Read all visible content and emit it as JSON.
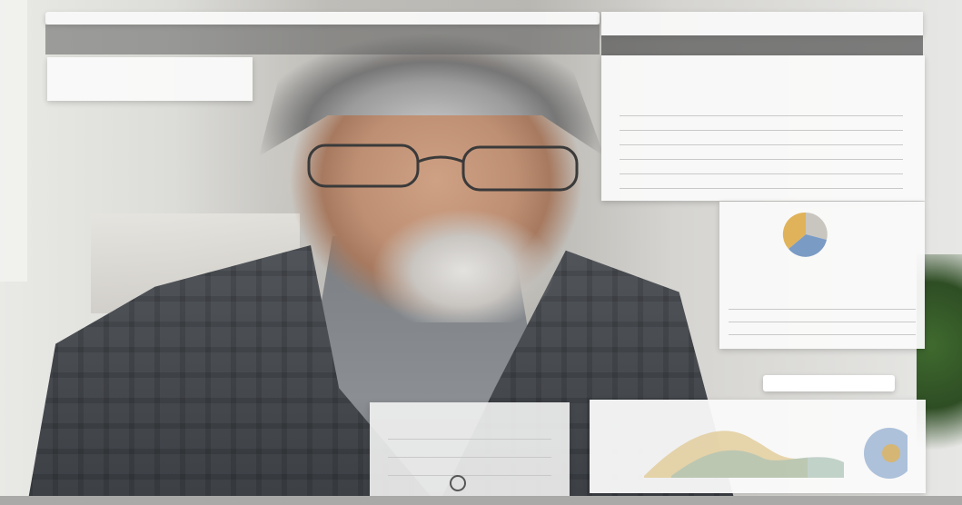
{
  "photo": {
    "subject": "",
    "backdrop_colors": {
      "wall": "#e4e4e1",
      "jacket": "#46494d",
      "shirt": "#858a8f",
      "skin": "#c4967a",
      "hair": "#9d9d9d"
    }
  },
  "overlay": {
    "top_bar": {
      "left_text": "",
      "right_text": ""
    },
    "dark_band": {
      "title": ""
    },
    "notification_card": {
      "title": "",
      "subtitle": ""
    },
    "report_panel": {
      "heading": "",
      "subheading": "",
      "rows": []
    },
    "chart_panel": {
      "label": "",
      "title": "",
      "value": ""
    },
    "small_button": {
      "label": ""
    },
    "dashboard_panel": {
      "label": ""
    },
    "tablet": {
      "label": ""
    },
    "colors": {
      "panel": "#f8f8f8",
      "band": "#5f5f5f",
      "chart_blue": "#7a9bc4",
      "chart_gold": "#e0b35a",
      "chart_gray": "#c9c6bf"
    }
  }
}
